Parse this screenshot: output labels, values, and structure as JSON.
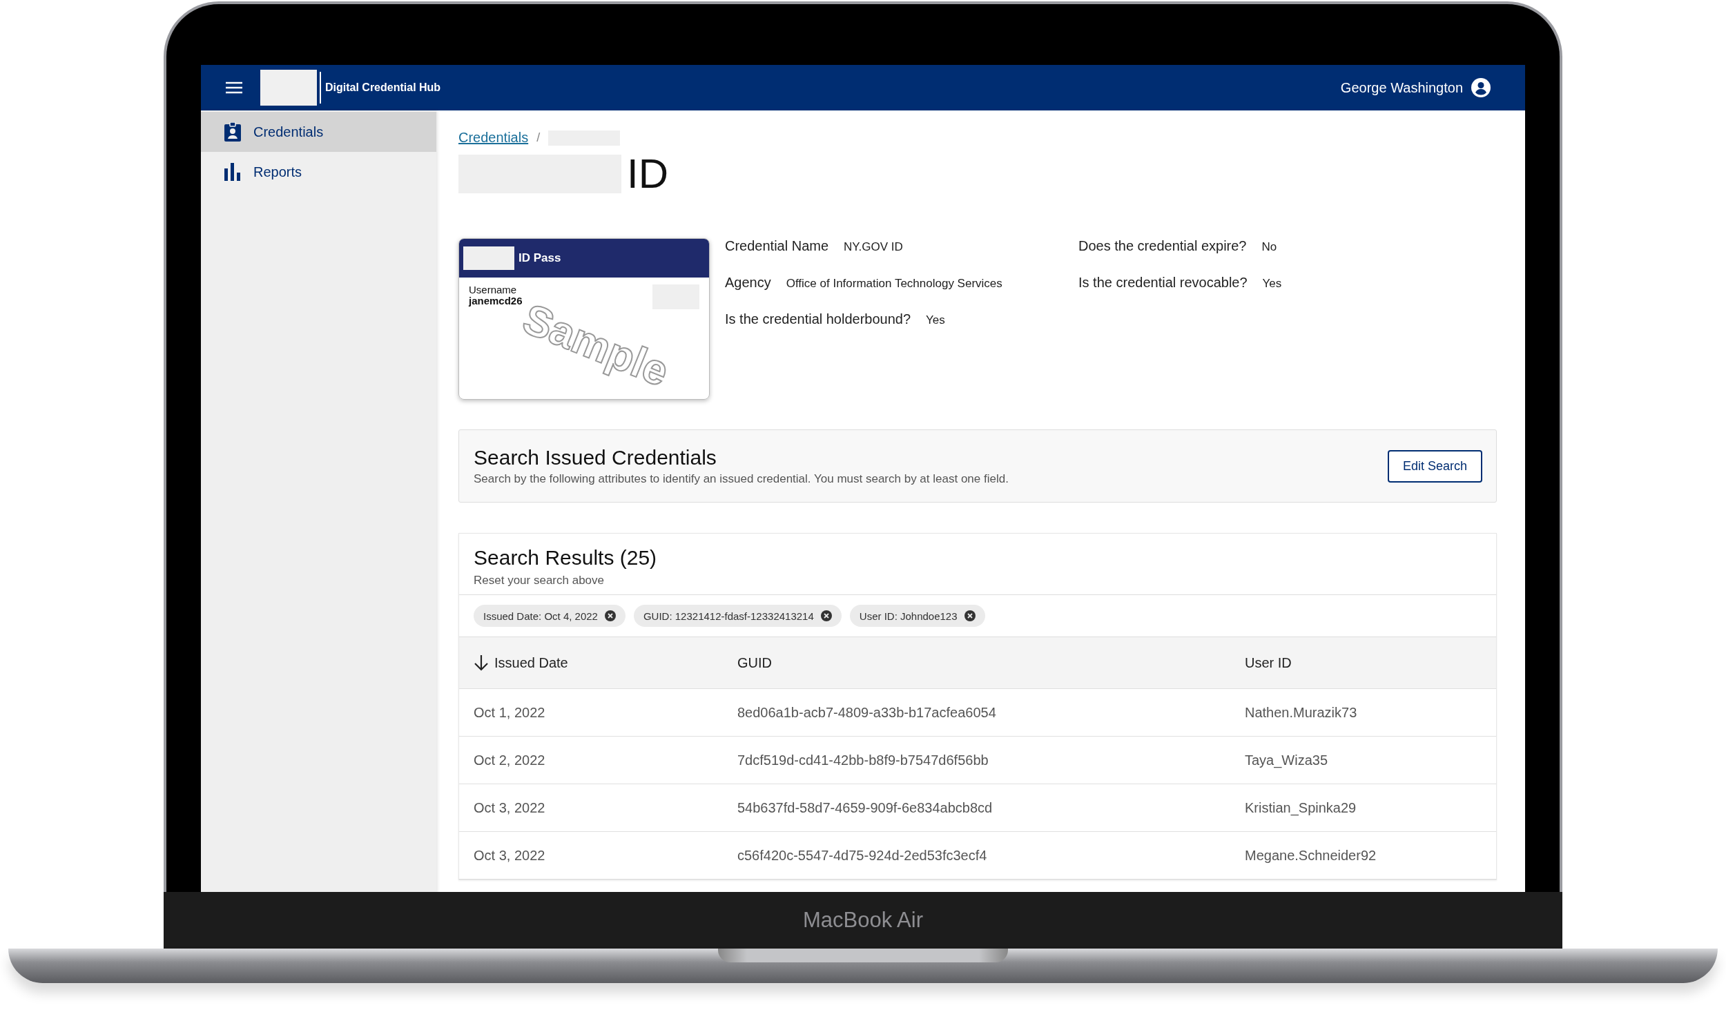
{
  "header": {
    "title": "Digital Credential Hub",
    "user": "George Washington"
  },
  "sidebar": {
    "items": [
      {
        "label": "Credentials",
        "kind": "badge",
        "selected": true
      },
      {
        "label": "Reports",
        "kind": "chart",
        "selected": false
      }
    ]
  },
  "breadcrumb": {
    "link": "Credentials",
    "separator": "/"
  },
  "page_title": "ID",
  "card": {
    "title": "ID Pass",
    "field_label": "Username",
    "field_value": "janemcd26",
    "stamp": "Sample"
  },
  "details": [
    {
      "label": "Credential Name",
      "value": "NY.GOV ID"
    },
    {
      "label": "Does the credential expire?",
      "value": "No"
    },
    {
      "label": "Agency",
      "value": "Office of Information Technology Services"
    },
    {
      "label": "Is the credential revocable?",
      "value": "Yes"
    },
    {
      "label": "Is the credential holderbound?",
      "value": "Yes"
    }
  ],
  "search": {
    "title": "Search Issued Credentials",
    "description": "Search by the following attributes to identify an issued credential. You must search by at least one field.",
    "button": "Edit Search"
  },
  "results": {
    "title": "Search Results (25)",
    "subtitle": "Reset your search above",
    "filters": [
      {
        "label": "Issued Date: Oct 4, 2022"
      },
      {
        "label": "GUID: 12321412-fdasf-12332413214"
      },
      {
        "label": "User ID: Johndoe123"
      }
    ],
    "columns": [
      {
        "label": "Issued Date",
        "sorted": true
      },
      {
        "label": "GUID",
        "sorted": false
      },
      {
        "label": "User ID",
        "sorted": false
      }
    ],
    "rows": [
      [
        "Oct 1, 2022",
        "8ed06a1b-acb7-4809-a33b-b17acfea6054",
        "Nathen.Murazik73"
      ],
      [
        "Oct 2, 2022",
        "7dcf519d-cd41-42bb-b8f9-b7547d6f56bb",
        "Taya_Wiza35"
      ],
      [
        "Oct 3, 2022",
        "54b637fd-58d7-4659-909f-6e834abcb8cd",
        "Kristian_Spinka29"
      ],
      [
        "Oct 3, 2022",
        "c56f420c-5547-4d75-924d-2ed53fc3ecf4",
        "Megane.Schneider92"
      ]
    ]
  },
  "device": {
    "label": "MacBook Air"
  }
}
